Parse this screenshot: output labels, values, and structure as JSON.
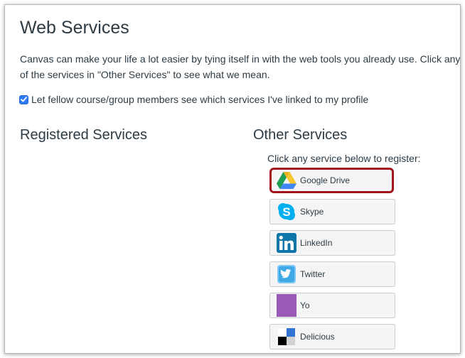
{
  "page": {
    "title": "Web Services",
    "intro": "Canvas can make your life a lot easier by tying itself in with the web tools you already use. Click any of the services in \"Other Services\" to see what we mean.",
    "share_checkbox": {
      "label": "Let fellow course/group members see which services I've linked to my profile",
      "checked": true
    }
  },
  "registered": {
    "title": "Registered Services"
  },
  "other": {
    "title": "Other Services",
    "hint": "Click any service below to register:",
    "services": [
      {
        "label": "Google Drive",
        "icon": "google-drive-icon",
        "highlighted": true
      },
      {
        "label": "Skype",
        "icon": "skype-icon",
        "highlighted": false
      },
      {
        "label": "LinkedIn",
        "icon": "linkedin-icon",
        "highlighted": false
      },
      {
        "label": "Twitter",
        "icon": "twitter-icon",
        "highlighted": false
      },
      {
        "label": "Yo",
        "icon": "yo-icon",
        "highlighted": false
      },
      {
        "label": "Delicious",
        "icon": "delicious-icon",
        "highlighted": false
      }
    ]
  },
  "colors": {
    "highlight_border": "#a0151c",
    "checkbox_accent": "#2f7bf3",
    "yo_purple": "#9b59b6",
    "linkedin_blue": "#0e76a8",
    "skype_blue": "#00aff0",
    "twitter_blue": "#55acee"
  }
}
